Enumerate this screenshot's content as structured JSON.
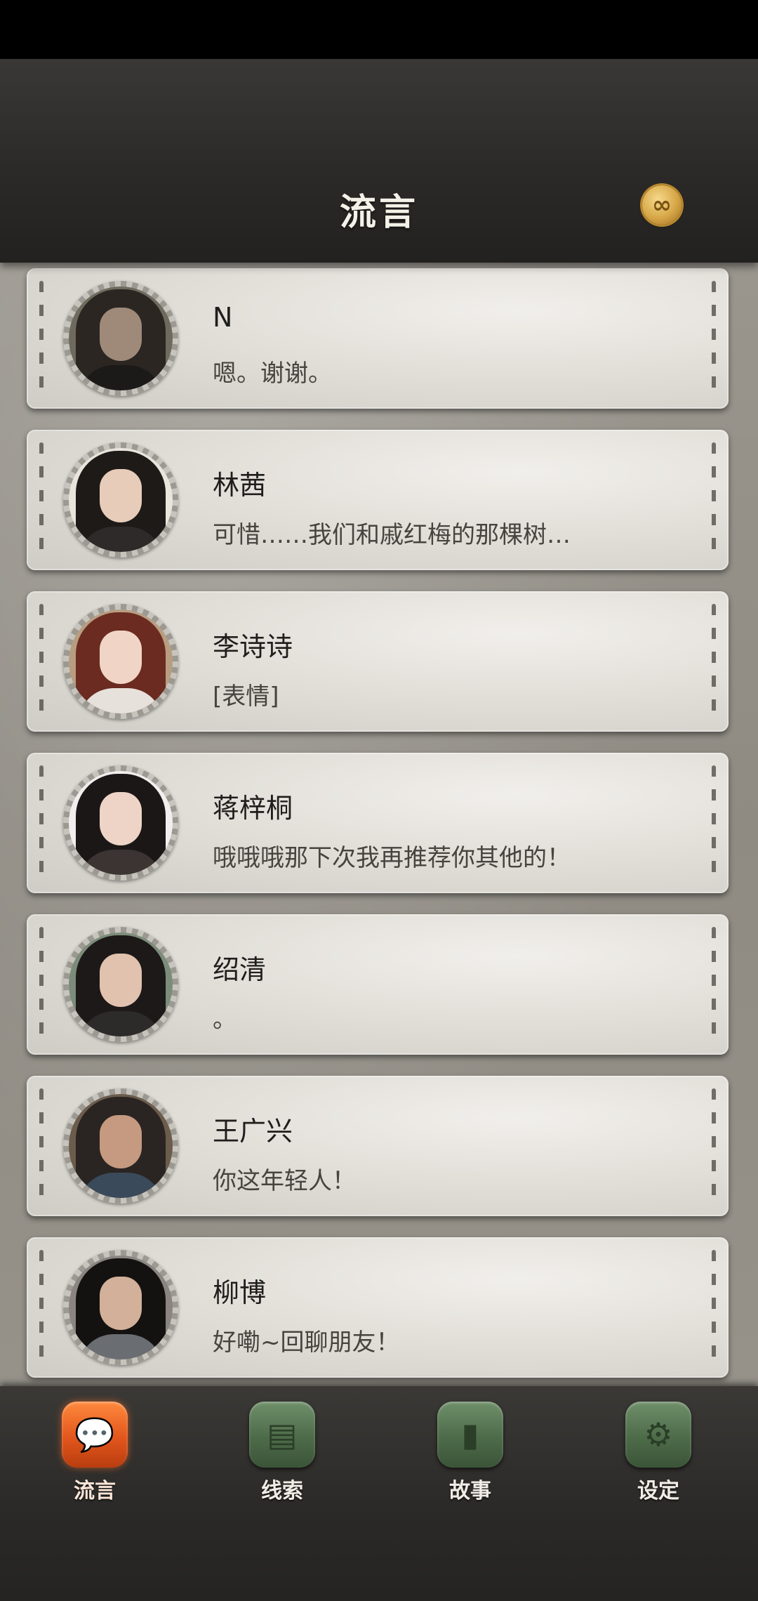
{
  "header": {
    "title": "流言",
    "currency_icon": "infinity-coin-icon"
  },
  "conversations": [
    {
      "name": "N",
      "message": "嗯。谢谢。",
      "avatar": {
        "hair": "#2b2622",
        "face": "#9f8a79",
        "body": "#1c1a18",
        "bg": "#6e6a5e"
      }
    },
    {
      "name": "林茜",
      "message": "可惜……我们和戚红梅的那棵树…",
      "avatar": {
        "hair": "#1e1a18",
        "face": "#e7cdb9",
        "body": "#2e2a2a",
        "bg": "#e9e4dc"
      }
    },
    {
      "name": "李诗诗",
      "message": "[表情]",
      "avatar": {
        "hair": "#6b2b20",
        "face": "#f0d5c6",
        "body": "#e7e1db",
        "bg": "#b89e80"
      }
    },
    {
      "name": "蒋梓桐",
      "message": "哦哦哦那下次我再推荐你其他的！",
      "avatar": {
        "hair": "#1b1716",
        "face": "#edd4c6",
        "body": "#3b3432",
        "bg": "#f2eeee"
      }
    },
    {
      "name": "绍清",
      "message": "。",
      "avatar": {
        "hair": "#1d1918",
        "face": "#e1c2ae",
        "body": "#2d2a2a",
        "bg": "#7c8c7a"
      }
    },
    {
      "name": "王广兴",
      "message": "你这年轻人！",
      "avatar": {
        "hair": "#2a2522",
        "face": "#c59a80",
        "body": "#3a4a5a",
        "bg": "#6b5c4c"
      }
    },
    {
      "name": "柳博",
      "message": "好嘞~回聊朋友！",
      "avatar": {
        "hair": "#141211",
        "face": "#d2b099",
        "body": "#6a6e72",
        "bg": "#8a8580"
      }
    }
  ],
  "tabs": [
    {
      "label": "流言",
      "icon": "chat-bubble-icon",
      "glyph": "💬",
      "active": true
    },
    {
      "label": "线索",
      "icon": "document-icon",
      "glyph": "▤",
      "active": false
    },
    {
      "label": "故事",
      "icon": "book-icon",
      "glyph": "▮",
      "active": false
    },
    {
      "label": "设定",
      "icon": "gear-icon",
      "glyph": "⚙",
      "active": false
    }
  ]
}
